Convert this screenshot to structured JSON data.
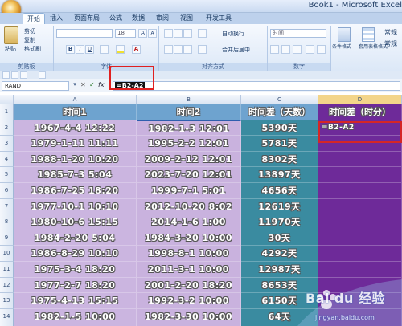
{
  "window": {
    "title": "Book1 - Microsoft Excel"
  },
  "ribbon": {
    "tabs": [
      "开始",
      "插入",
      "页面布局",
      "公式",
      "数据",
      "审阅",
      "视图",
      "开发工具"
    ],
    "clipboard": {
      "paste": "粘贴",
      "cut": "剪切",
      "copy": "复制",
      "format_painter": "格式刷",
      "group_label": "剪贴板"
    },
    "font": {
      "size": "18",
      "bold": "B",
      "italic": "I",
      "underline": "U",
      "grow": "A",
      "shrink": "A",
      "color_a": "A",
      "group_label": "字体"
    },
    "alignment": {
      "wrap_text": "自动换行",
      "merge_center": "合并后居中",
      "group_label": "对齐方式"
    },
    "number": {
      "format": "时间",
      "group_label": "数字"
    },
    "styles": {
      "conditional": "条件格式",
      "table_format": "套用表格格式",
      "cell_style_1": "常规",
      "cell_style_2": "常规"
    }
  },
  "formula_bar": {
    "name_box": "RAND",
    "fx": "fx",
    "cancel": "✕",
    "enter": "✓",
    "formula": "=B2-A2"
  },
  "sheet": {
    "columns": [
      "A",
      "B",
      "C",
      "D"
    ],
    "rows": [
      "1",
      "2",
      "3",
      "4",
      "5",
      "6",
      "7",
      "8",
      "9",
      "10",
      "11",
      "12",
      "13",
      "14",
      "15"
    ],
    "headers": [
      "时间1",
      "时间2",
      "时间差（天数）",
      "时间差（时分）"
    ],
    "data": [
      [
        "1967-4-4 12:22",
        "1982-1-3 12:01",
        "5390天",
        "=B2-A2"
      ],
      [
        "1979-1-11 11:11",
        "1995-2-2 12:01",
        "5781天",
        ""
      ],
      [
        "1988-1-20 10:20",
        "2009-2-12 12:01",
        "8302天",
        ""
      ],
      [
        "1985-7-3 5:04",
        "2023-7-20 12:01",
        "13897天",
        ""
      ],
      [
        "1986-7-25 18:20",
        "1999-7-1 5:01",
        "4656天",
        ""
      ],
      [
        "1977-10-1 10:10",
        "2012-10-20 8:02",
        "12619天",
        ""
      ],
      [
        "1980-10-6 15:15",
        "2014-1-6 1:00",
        "11970天",
        ""
      ],
      [
        "1984-2-20 5:04",
        "1984-3-20 10:00",
        "30天",
        ""
      ],
      [
        "1986-8-29 10:10",
        "1998-8-1 10:00",
        "4292天",
        ""
      ],
      [
        "1975-3-4 18:20",
        "2011-3-1 10:00",
        "12987天",
        ""
      ],
      [
        "1977-2-7 18:20",
        "2001-2-20 18:20",
        "8653天",
        ""
      ],
      [
        "1975-4-13 15:15",
        "1992-3-2 10:00",
        "6150天",
        ""
      ],
      [
        "1982-1-5 10:00",
        "1982-3-30 10:00",
        "64天",
        ""
      ]
    ]
  },
  "watermark": {
    "logo": "Bai du 经验",
    "url": "jingyan.baidu.com"
  },
  "colors": {
    "col_a": "#cbb5e0",
    "col_b": "#c9b2de",
    "col_c": "#3a8ba0",
    "col_d": "#6e2a99",
    "header_row": "#6ea3cf",
    "accent": "#e02020"
  }
}
